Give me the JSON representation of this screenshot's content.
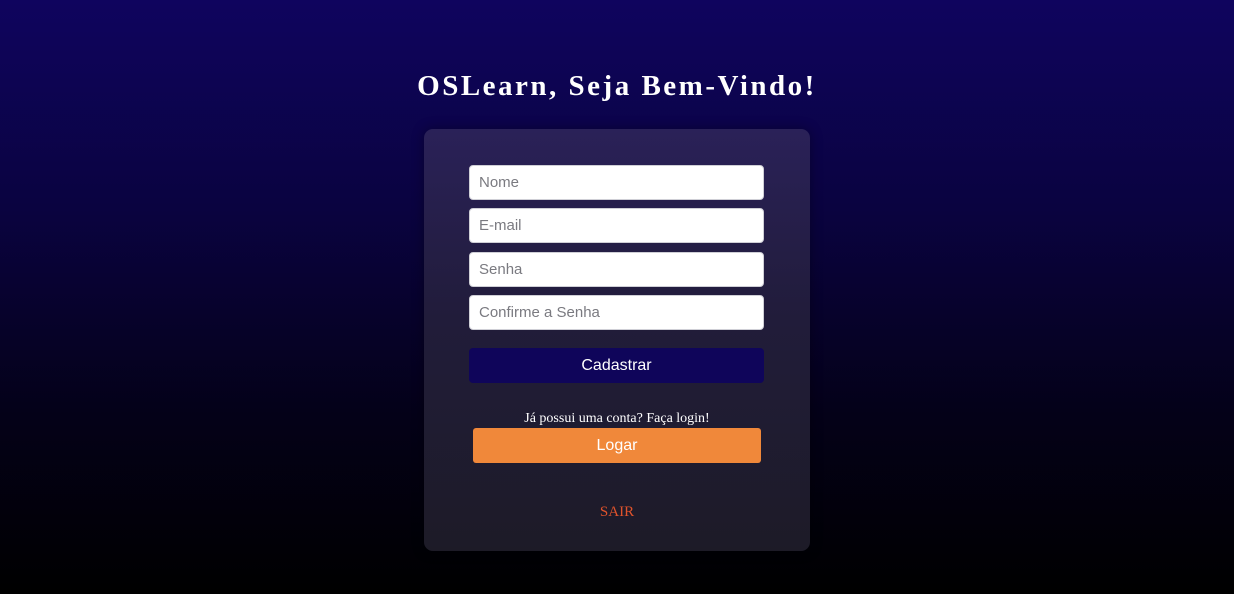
{
  "header": {
    "title": "OSLearn, Seja Bem-Vindo!"
  },
  "form": {
    "nome_placeholder": "Nome",
    "email_placeholder": "E-mail",
    "senha_placeholder": "Senha",
    "confirm_placeholder": "Confirme a Senha",
    "submit_label": "Cadastrar"
  },
  "login": {
    "prompt": "Já possui uma conta? Faça login!",
    "button_label": "Logar"
  },
  "footer": {
    "exit_label": "SAIR"
  },
  "colors": {
    "primary_button": "#0f055a",
    "login_button": "#f0883a",
    "exit_link": "#e0532c"
  }
}
